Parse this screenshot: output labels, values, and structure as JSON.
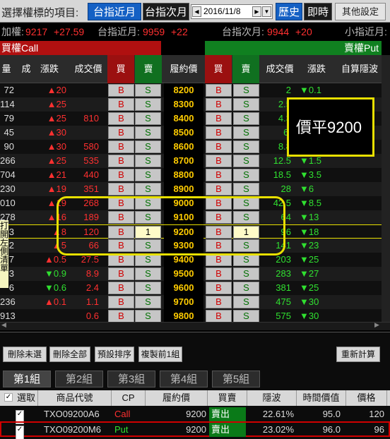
{
  "topbar": {
    "title": "選擇權標的項目:",
    "btn_near": "台指近月",
    "btn_next": "台指次月",
    "date": "2016/11/8",
    "btn_history": "歷史",
    "btn_realtime": "即時",
    "btn_settings": "其他設定"
  },
  "index": {
    "weighted_label": "加權:",
    "weighted_value": "9217",
    "weighted_change": "+27.59",
    "near_label": "台指近月:",
    "near_value": "9959",
    "near_change": "+22",
    "next_label": "台指次月:",
    "next_value": "9944",
    "next_change": "+20",
    "mini_label": "小指近月:"
  },
  "call_label": "買權Call",
  "put_label": "賣權Put",
  "headers": {
    "vol": "量",
    "chg_pct": "成",
    "call_change": "漲跌",
    "call_price": "成交價",
    "buy": "買",
    "sell": "賣",
    "strike": "履約價",
    "put_buy": "買",
    "put_sell": "賣",
    "put_price": "成交價",
    "put_change": "漲跌",
    "custom": "自算隱波"
  },
  "colors": {
    "up": "#ff3030",
    "down": "#30e030",
    "strike": "#ffcc00",
    "atm_band": "#f5f5c0",
    "callout": "#e8e000"
  },
  "rows": [
    {
      "vol": "72",
      "cchg": "▲20",
      "cprice": "",
      "strike": "8200",
      "pprice": "2",
      "pchg": "▼0.1"
    },
    {
      "vol": "114",
      "cchg": "▲25",
      "cprice": "",
      "strike": "8300",
      "pprice": "2.5",
      "pchg": "▼0.4"
    },
    {
      "vol": "79",
      "cchg": "▲25",
      "cprice": "810",
      "strike": "8400",
      "pprice": "4.3",
      "pchg": ""
    },
    {
      "vol": "45",
      "cchg": "▲30",
      "cprice": "",
      "strike": "8500",
      "pprice": "6.",
      "pchg": ""
    },
    {
      "vol": "90",
      "cchg": "▲30",
      "cprice": "580",
      "strike": "8600",
      "pprice": "8.8",
      "pchg": "▼0.2"
    },
    {
      "vol": "266",
      "cchg": "▲25",
      "cprice": "535",
      "strike": "8700",
      "pprice": "12.5",
      "pchg": "▼1.5"
    },
    {
      "vol": "704",
      "cchg": "▲21",
      "cprice": "440",
      "strike": "8800",
      "pprice": "18.5",
      "pchg": "▼3.5"
    },
    {
      "vol": "230",
      "cchg": "▲19",
      "cprice": "351",
      "strike": "8900",
      "pprice": "28",
      "pchg": "▼6"
    },
    {
      "vol": "010",
      "cchg": "▲19",
      "cprice": "268",
      "strike": "9000",
      "pprice": "42.5",
      "pchg": "▼8.5"
    },
    {
      "vol": "278",
      "cchg": "▲16",
      "cprice": "189",
      "strike": "9100",
      "pprice": "64",
      "pchg": "▼13"
    },
    {
      "vol": "3",
      "cchg": "▲8",
      "cprice": "120",
      "strike": "9200",
      "pprice": "96",
      "pchg": "▼18",
      "qty": "1"
    },
    {
      "vol": "2",
      "cchg": "▲5",
      "cprice": "66",
      "strike": "9300",
      "pprice": "141",
      "pchg": "▼23"
    },
    {
      "vol": "7",
      "cchg": "▲0.5",
      "cprice": "27.5",
      "strike": "9400",
      "pprice": "203",
      "pchg": "▼25"
    },
    {
      "vol": "3",
      "cchg": "▼0.9",
      "cprice": "8.9",
      "strike": "9500",
      "pprice": "283",
      "pchg": "▼27"
    },
    {
      "vol": "6",
      "cchg": "▼0.6",
      "cprice": "2.4",
      "strike": "9600",
      "pprice": "381",
      "pchg": "▼25"
    },
    {
      "vol": "236",
      "cchg": "▲0.1",
      "cprice": "1.1",
      "strike": "9700",
      "pprice": "475",
      "pchg": "▼30"
    },
    {
      "vol": "913",
      "cchg": "",
      "cprice": "0.6",
      "strike": "9800",
      "pprice": "575",
      "pchg": "▼30"
    }
  ],
  "b_label": "B",
  "s_label": "S",
  "side_note": "打開左側清單",
  "callout_text": "價平9200",
  "bottom": {
    "btn_delete_unselected": "刪除未選",
    "btn_delete_all": "刪除全部",
    "btn_default_sort": "預設排序",
    "btn_copy_prev": "複製前1組",
    "btn_recalc": "重新計算",
    "tabs": [
      "第1組",
      "第2組",
      "第3組",
      "第4組",
      "第5組"
    ],
    "cols": {
      "select": "選取",
      "code": "商品代號",
      "cp": "CP",
      "strike": "履約價",
      "side": "買賣",
      "iv": "隱波",
      "time_value": "時間價值",
      "price": "價格"
    },
    "positions": [
      {
        "code": "TXO09200A6",
        "cp": "Call",
        "strike": "9200",
        "side": "賣出",
        "iv": "22.61%",
        "time_value": "95.0",
        "price": "120"
      },
      {
        "code": "TXO09200M6",
        "cp": "Put",
        "strike": "9200",
        "side": "賣出",
        "iv": "23.02%",
        "time_value": "96.0",
        "price": "96"
      }
    ]
  }
}
